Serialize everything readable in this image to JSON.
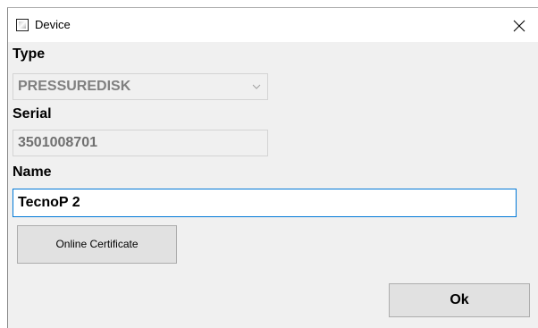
{
  "window": {
    "title": "Device",
    "icon": "app-window-icon",
    "close_icon": "close-icon"
  },
  "form": {
    "type": {
      "label": "Type",
      "value": "PRESSUREDISK",
      "enabled": false,
      "chevron_icon": "chevron-down-icon"
    },
    "serial": {
      "label": "Serial",
      "value": "3501008701",
      "readonly": true
    },
    "name": {
      "label": "Name",
      "value": "TecnoP 2"
    }
  },
  "buttons": {
    "certificate_label": "Online Certificate",
    "ok_label": "Ok"
  },
  "colors": {
    "focus_border": "#0078d7",
    "dialog_bg": "#f0f0f0",
    "button_bg": "#e1e1e1",
    "disabled_text": "#808080"
  }
}
